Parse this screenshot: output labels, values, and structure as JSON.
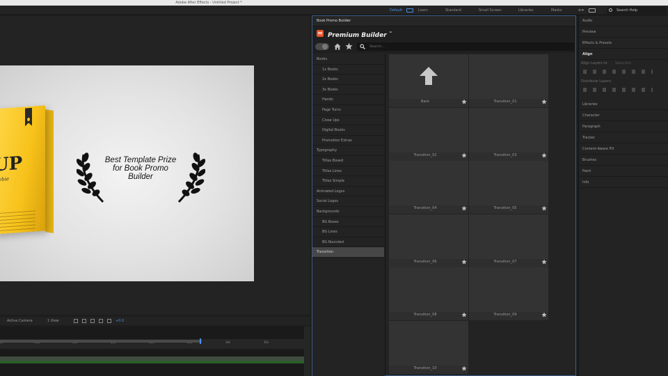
{
  "window": {
    "title": "Adobe After Effects - Untitled Project *"
  },
  "workspace": {
    "tabs": [
      {
        "label": "Default",
        "active": true
      },
      {
        "label": "Learn",
        "active": false
      },
      {
        "label": "Standard",
        "active": false
      },
      {
        "label": "Small Screen",
        "active": false
      },
      {
        "label": "Libraries",
        "active": false
      },
      {
        "label": "Masks",
        "active": false
      }
    ],
    "help_placeholder": "Search Help",
    "overflow_label": ">>"
  },
  "viewer": {
    "book_title": "UP",
    "book_subtitle": "ebie",
    "award_text": "Best Template Prize for Book Promo Builder",
    "toolbar": {
      "camera": "Active Camera",
      "view": "1 View",
      "offset": "+0.0"
    }
  },
  "timeline": {
    "ticks": [
      "0s",
      "05s",
      "10s",
      "15s",
      "20s",
      "25s",
      "30s",
      "35s"
    ]
  },
  "panel": {
    "tab_label": "Book Promo Builder",
    "brand_name": "Premium Builder",
    "brand_mark": "™",
    "search_placeholder": "Search...",
    "categories": [
      {
        "label": "Books",
        "sub": false,
        "active": false
      },
      {
        "label": "1x Books",
        "sub": true,
        "active": false
      },
      {
        "label": "2x Books",
        "sub": true,
        "active": false
      },
      {
        "label": "3x Books",
        "sub": true,
        "active": false
      },
      {
        "label": "Hands",
        "sub": true,
        "active": false
      },
      {
        "label": "Page Turns",
        "sub": true,
        "active": false
      },
      {
        "label": "Close Ups",
        "sub": true,
        "active": false
      },
      {
        "label": "Digital Books",
        "sub": true,
        "active": false
      },
      {
        "label": "Promotion Extras",
        "sub": true,
        "active": false
      },
      {
        "label": "Typography",
        "sub": false,
        "active": false
      },
      {
        "label": "Titles Boxed",
        "sub": true,
        "active": false
      },
      {
        "label": "Titles Lines",
        "sub": true,
        "active": false
      },
      {
        "label": "Titles Simple",
        "sub": true,
        "active": false
      },
      {
        "label": "Animated Logos",
        "sub": false,
        "active": false
      },
      {
        "label": "Social Logos",
        "sub": false,
        "active": false
      },
      {
        "label": "Backgrounds",
        "sub": false,
        "active": false
      },
      {
        "label": "BG Boxes",
        "sub": true,
        "active": false
      },
      {
        "label": "BG Lines",
        "sub": true,
        "active": false
      },
      {
        "label": "BG Rounded",
        "sub": true,
        "active": false
      },
      {
        "label": "Transition",
        "sub": false,
        "active": true
      }
    ],
    "tiles": [
      {
        "label": "Back",
        "is_back": true,
        "favorite": true
      },
      {
        "label": "Transition_01",
        "is_back": false,
        "favorite": true
      },
      {
        "label": "Transition_02",
        "is_back": false,
        "favorite": true
      },
      {
        "label": "Transition_03",
        "is_back": false,
        "favorite": true
      },
      {
        "label": "Transition_04",
        "is_back": false,
        "favorite": true
      },
      {
        "label": "Transition_05",
        "is_back": false,
        "favorite": true
      },
      {
        "label": "Transition_06",
        "is_back": false,
        "favorite": true
      },
      {
        "label": "Transition_07",
        "is_back": false,
        "favorite": true
      },
      {
        "label": "Transition_08",
        "is_back": false,
        "favorite": true
      },
      {
        "label": "Transition_09",
        "is_back": false,
        "favorite": true
      },
      {
        "label": "Transition_10",
        "is_back": false,
        "favorite": true
      }
    ]
  },
  "right_panels": {
    "items": [
      "Audio",
      "Preview",
      "Effects & Presets",
      "Align",
      "Libraries",
      "Character",
      "Paragraph",
      "Tracker",
      "Content-Aware Fill",
      "Brushes",
      "Paint",
      "Info"
    ],
    "align_to_label": "Align Layers to:",
    "align_to_value": "Selection",
    "distribute_label": "Distribute Layers:"
  },
  "colors": {
    "accent": "#4a8fe6",
    "brand": "#e8532b",
    "book": "#f7c21a",
    "panel_border": "#3a5f8a"
  }
}
